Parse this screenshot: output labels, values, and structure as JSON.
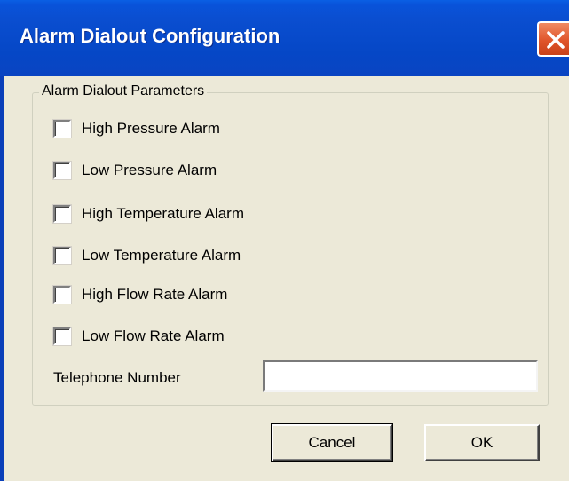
{
  "window": {
    "title": "Alarm Dialout Configuration",
    "close_icon": "close-icon",
    "colors": {
      "titlebar": "#0a4ed0",
      "close": "#e0552a",
      "face": "#ece9d8"
    }
  },
  "group": {
    "label": "Alarm Dialout Parameters",
    "checkboxes": [
      {
        "label": "High Pressure Alarm",
        "checked": false
      },
      {
        "label": "Low Pressure Alarm",
        "checked": false
      },
      {
        "label": "High Temperature Alarm",
        "checked": false
      },
      {
        "label": "Low Temperature Alarm",
        "checked": false
      },
      {
        "label": "High Flow Rate Alarm",
        "checked": false
      },
      {
        "label": "Low Flow Rate Alarm",
        "checked": false
      }
    ],
    "telephone": {
      "label": "Telephone Number",
      "value": ""
    }
  },
  "buttons": {
    "cancel": "Cancel",
    "ok": "OK"
  }
}
